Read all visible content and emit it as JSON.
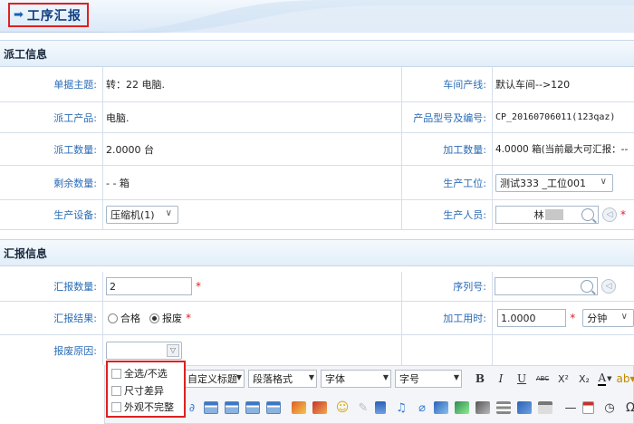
{
  "title": "工序汇报",
  "dispatch_section": {
    "heading": "派工信息",
    "subject_label": "单据主题:",
    "subject_value": "转：22 电脑.",
    "line_label": "车间产线:",
    "line_value": "默认车间-->120",
    "product_label": "派工产品:",
    "product_value": "电脑.",
    "model_label": "产品型号及编号:",
    "model_value": "CP_20160706011(123qaz)",
    "qty_label": "派工数量:",
    "qty_value": "2.0000 台",
    "proc_qty_label": "加工数量:",
    "proc_qty_value": "4.0000 箱(当前最大可汇报：--",
    "remain_label": "剩余数量:",
    "remain_value": "- - 箱",
    "station_label": "生产工位:",
    "station_value": "测试333 _工位001",
    "equip_label": "生产设备:",
    "equip_value": "压缩机(1)",
    "staff_label": "生产人员:",
    "staff_value": "林"
  },
  "report_section": {
    "heading": "汇报信息",
    "report_qty_label": "汇报数量:",
    "report_qty_value": "2",
    "serial_label": "序列号:",
    "serial_value": "",
    "result_label": "汇报结果:",
    "result_options": [
      "合格",
      "报废"
    ],
    "result_selected": "报废",
    "time_label": "加工用时:",
    "time_value": "1.0000",
    "time_unit": "分钟",
    "scrap_label": "报废原因:"
  },
  "scrap_dropdown": {
    "items": [
      "全选/不选",
      "尺寸差异",
      "外观不完整"
    ]
  },
  "editor_toolbar": {
    "custom_title": "自定义标题",
    "paragraph": "段落格式",
    "font": "字体",
    "size": "字号",
    "bold": "B",
    "italic": "I",
    "underline": "U",
    "strike": "ABC",
    "sup": "X²",
    "sub": "X₂",
    "font_color": "A",
    "omega": "Ω"
  },
  "colors": {
    "label_blue": "#2b6cb7",
    "title_blue": "#0f3e83",
    "required_red": "#e02020",
    "highlight_border": "#e02020"
  }
}
